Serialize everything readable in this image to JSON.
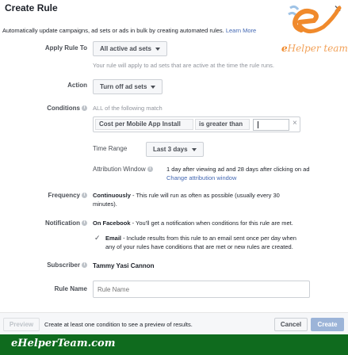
{
  "dialog": {
    "title": "Create Rule",
    "close_glyph": "✕",
    "description": "Automatically update campaigns, ad sets or ads in bulk by creating automated rules.",
    "learn_more": "Learn More"
  },
  "watermark": {
    "logo_letter": "e",
    "text_prefix": "e",
    "text_rest": "Helper team"
  },
  "apply_rule_to": {
    "label": "Apply Rule To",
    "value": "All active ad sets",
    "hint": "Your rule will apply to ad sets that are active at the time the rule runs."
  },
  "action": {
    "label": "Action",
    "value": "Turn off ad sets"
  },
  "conditions": {
    "label": "Conditions",
    "heading": "ALL of the following match",
    "metric": "Cost per Mobile App Install",
    "operator": "is greater than",
    "value": "",
    "remove_glyph": "×"
  },
  "time_range": {
    "label": "Time Range",
    "value": "Last 3 days"
  },
  "attribution_window": {
    "label": "Attribution Window",
    "value": "1 day after viewing ad and 28 days after clicking on ad",
    "change_link": "Change attribution window"
  },
  "frequency": {
    "label": "Frequency",
    "bold": "Continuously",
    "rest": " - This rule will run as often as possible (usually every 30",
    "rest2": "minutes)."
  },
  "notification": {
    "label": "Notification",
    "bold": "On Facebook",
    "rest": " - You'll get a notification when conditions for this rule are met.",
    "email_checked": true,
    "email_bold": "Email",
    "email_rest": " - Include results from this rule to an email sent once per day when",
    "email_rest2": "any of your rules have conditions that are met or new rules are created."
  },
  "subscriber": {
    "label": "Subscriber",
    "name": "Tammy Yasi Cannon"
  },
  "rule_name": {
    "label": "Rule Name",
    "placeholder": "Rule Name"
  },
  "footer": {
    "preview": "Preview",
    "hint": "Create at least one condition to see a preview of results.",
    "cancel": "Cancel",
    "create": "Create"
  },
  "brand_bar": {
    "text": "eHelperTeam.com"
  },
  "colors": {
    "link": "#4267b2",
    "create_button": "#9cb4d8",
    "brand_bar": "#0f6b1e",
    "watermark": "#f08a2c"
  }
}
